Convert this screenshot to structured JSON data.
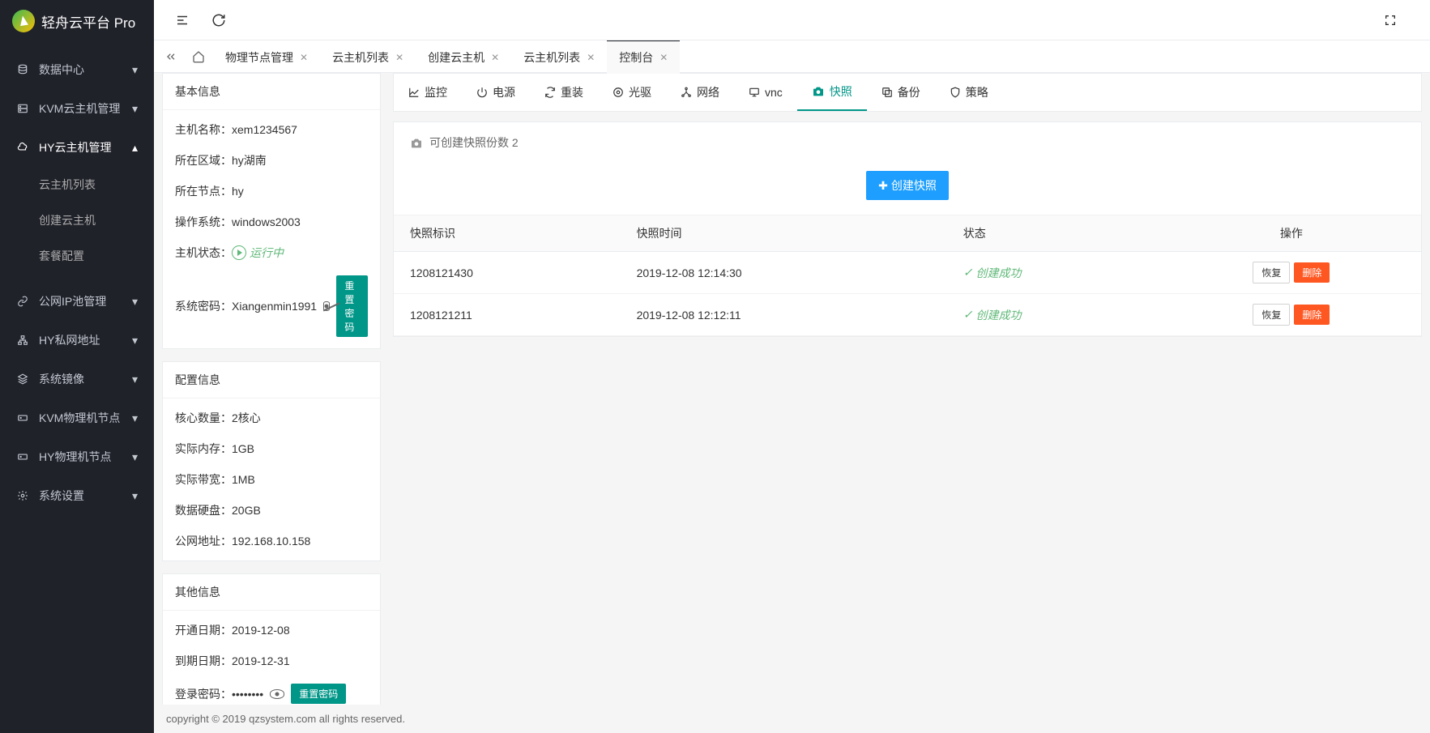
{
  "app_title": "轻舟云平台 Pro",
  "sidebar": {
    "items": [
      {
        "icon": "database",
        "label": "数据中心",
        "expand": "down"
      },
      {
        "icon": "server",
        "label": "KVM云主机管理",
        "expand": "down"
      },
      {
        "icon": "cloud",
        "label": "HY云主机管理",
        "expand": "up"
      },
      {
        "icon": "link",
        "label": "公网IP池管理",
        "expand": "down"
      },
      {
        "icon": "lan",
        "label": "HY私网地址",
        "expand": "down"
      },
      {
        "icon": "layers",
        "label": "系统镜像",
        "expand": "down"
      },
      {
        "icon": "drive",
        "label": "KVM物理机节点",
        "expand": "down"
      },
      {
        "icon": "drive",
        "label": "HY物理机节点",
        "expand": "down"
      },
      {
        "icon": "gear",
        "label": "系统设置",
        "expand": "down"
      }
    ],
    "submenu": [
      "云主机列表",
      "创建云主机",
      "套餐配置"
    ]
  },
  "tabs": [
    "物理节点管理",
    "云主机列表",
    "创建云主机",
    "云主机列表",
    "控制台"
  ],
  "active_tab": "控制台",
  "basic_info": {
    "title": "基本信息",
    "rows": {
      "host_name": {
        "label": "主机名称：",
        "value": "xem1234567"
      },
      "region": {
        "label": "所在区域：",
        "value": "hy湖南"
      },
      "node": {
        "label": "所在节点：",
        "value": "hy"
      },
      "os": {
        "label": "操作系统：",
        "value": "windows2003"
      },
      "status": {
        "label": "主机状态：",
        "value": "运行中"
      },
      "syspwd": {
        "label": "系统密码：",
        "value": "Xiangenmin1991",
        "button": "重置密码"
      }
    }
  },
  "config_info": {
    "title": "配置信息",
    "rows": {
      "cores": {
        "label": "核心数量：",
        "value": "2核心"
      },
      "mem": {
        "label": "实际内存：",
        "value": "1GB"
      },
      "bw": {
        "label": "实际带宽：",
        "value": "1MB"
      },
      "disk": {
        "label": "数据硬盘：",
        "value": "20GB"
      },
      "ip": {
        "label": "公网地址：",
        "value": "192.168.10.158"
      }
    }
  },
  "other_info": {
    "title": "其他信息",
    "rows": {
      "open": {
        "label": "开通日期：",
        "value": "2019-12-08"
      },
      "expire": {
        "label": "到期日期：",
        "value": "2019-12-31"
      },
      "loginpwd": {
        "label": "登录密码：",
        "value": "••••••••",
        "button": "重置密码"
      }
    }
  },
  "inner_tabs": [
    {
      "icon": "chart",
      "label": "监控"
    },
    {
      "icon": "power",
      "label": "电源"
    },
    {
      "icon": "reload",
      "label": "重装"
    },
    {
      "icon": "disc",
      "label": "光驱"
    },
    {
      "icon": "network",
      "label": "网络"
    },
    {
      "icon": "monitor",
      "label": "vnc"
    },
    {
      "icon": "camera",
      "label": "快照"
    },
    {
      "icon": "backup",
      "label": "备份"
    },
    {
      "icon": "shield",
      "label": "策略"
    }
  ],
  "active_inner_tab": "快照",
  "snapshot": {
    "header": "可创建快照份数 2",
    "create_button": "创建快照",
    "columns": [
      "快照标识",
      "快照时间",
      "状态",
      "操作"
    ],
    "rows": [
      {
        "id": "1208121430",
        "time": "2019-12-08 12:14:30",
        "status": "创建成功"
      },
      {
        "id": "1208121211",
        "time": "2019-12-08 12:12:11",
        "status": "创建成功"
      }
    ],
    "restore_button": "恢复",
    "delete_button": "删除"
  },
  "footer": "copyright © 2019 qzsystem.com all rights reserved."
}
